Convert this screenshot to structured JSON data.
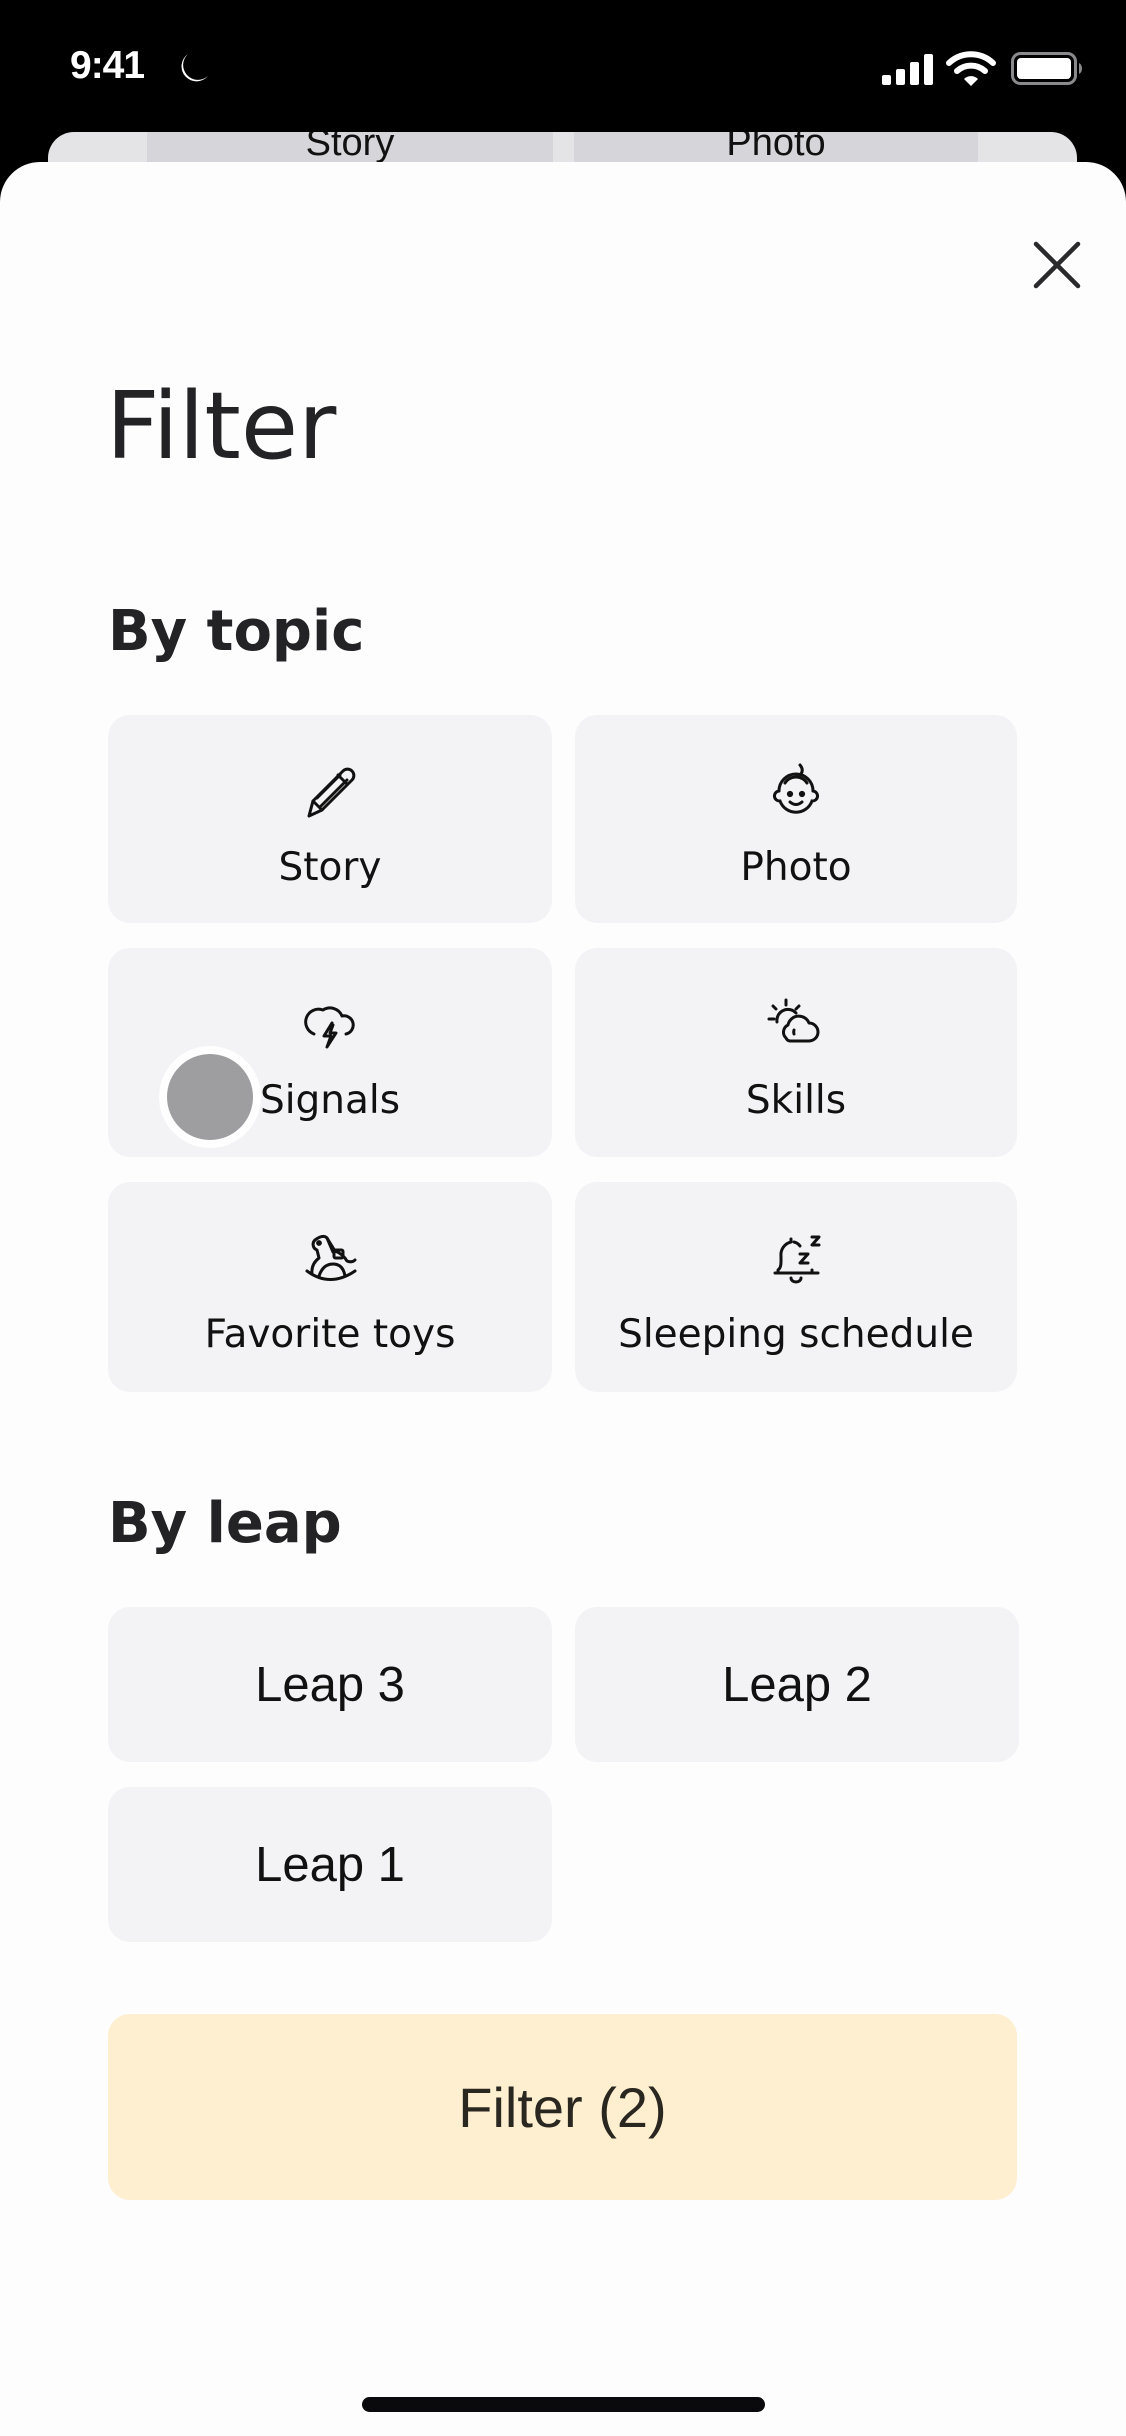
{
  "status_bar": {
    "time": "9:41",
    "focus_icon": "moon-icon",
    "signal_icon": "cellular-signal-icon",
    "wifi_icon": "wifi-icon",
    "battery_icon": "battery-icon"
  },
  "background_sheet": {
    "chips": [
      {
        "label": "Story"
      },
      {
        "label": "Photo"
      }
    ]
  },
  "sheet": {
    "close_icon": "close-icon",
    "title": "Filter",
    "sections": {
      "topic": {
        "heading": "By topic",
        "items": [
          {
            "label": "Story",
            "icon": "pencil-icon"
          },
          {
            "label": "Photo",
            "icon": "baby-face-icon"
          },
          {
            "label": "Signals",
            "icon": "storm-cloud-icon"
          },
          {
            "label": "Skills",
            "icon": "sun-cloud-icon"
          },
          {
            "label": "Favorite toys",
            "icon": "rocking-horse-icon"
          },
          {
            "label": "Sleeping schedule",
            "icon": "bell-sleep-icon"
          }
        ]
      },
      "leap": {
        "heading": "By leap",
        "items": [
          {
            "label": "Leap 3"
          },
          {
            "label": "Leap 2"
          },
          {
            "label": "Leap 1"
          }
        ]
      }
    },
    "filter_button": {
      "label": "Filter (2)",
      "count": 2
    },
    "colors": {
      "card_bg": "#F3F2F5",
      "filter_button_bg": "#FDEFCF",
      "text": "#232326"
    }
  }
}
